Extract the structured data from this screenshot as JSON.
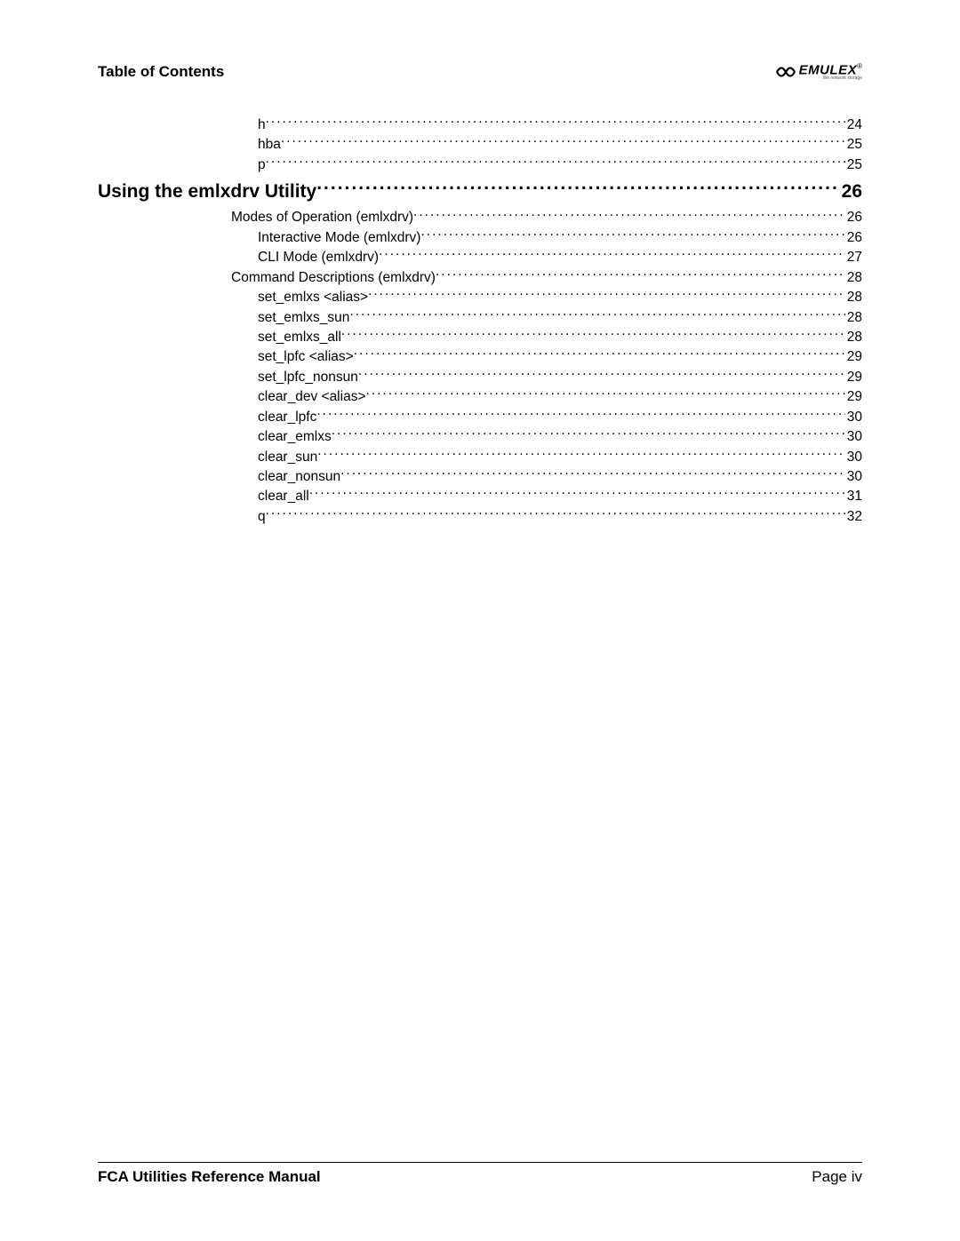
{
  "header": {
    "title": "Table of Contents",
    "logo_text": "EMULEX",
    "logo_tagline": "We network storage"
  },
  "toc": {
    "pre_entries": [
      {
        "level": 3,
        "title": "h",
        "page": "24"
      },
      {
        "level": 3,
        "title": "hba",
        "page": "25"
      },
      {
        "level": 3,
        "title": "p",
        "page": "25"
      }
    ],
    "section": {
      "title": "Using the emlxdrv Utility",
      "page": "26"
    },
    "entries": [
      {
        "level": 2,
        "title": "Modes of Operation (emlxdrv)",
        "page": "26"
      },
      {
        "level": 3,
        "title": "Interactive Mode (emlxdrv)",
        "page": "26"
      },
      {
        "level": 3,
        "title": "CLI Mode (emlxdrv)",
        "page": "27"
      },
      {
        "level": 2,
        "title": "Command Descriptions (emlxdrv)",
        "page": "28"
      },
      {
        "level": 3,
        "title": "set_emlxs <alias>",
        "page": "28"
      },
      {
        "level": 3,
        "title": "set_emlxs_sun",
        "page": "28"
      },
      {
        "level": 3,
        "title": "set_emlxs_all",
        "page": "28"
      },
      {
        "level": 3,
        "title": "set_lpfc <alias>",
        "page": "29"
      },
      {
        "level": 3,
        "title": "set_lpfc_nonsun",
        "page": "29"
      },
      {
        "level": 3,
        "title": "clear_dev <alias>",
        "page": "29"
      },
      {
        "level": 3,
        "title": "clear_lpfc",
        "page": "30"
      },
      {
        "level": 3,
        "title": "clear_emlxs",
        "page": "30"
      },
      {
        "level": 3,
        "title": "clear_sun",
        "page": "30"
      },
      {
        "level": 3,
        "title": "clear_nonsun",
        "page": "30"
      },
      {
        "level": 3,
        "title": "clear_all",
        "page": "31"
      },
      {
        "level": 3,
        "title": "q",
        "page": "32"
      }
    ]
  },
  "footer": {
    "manual": "FCA Utilities Reference Manual",
    "page_label": "Page iv"
  }
}
